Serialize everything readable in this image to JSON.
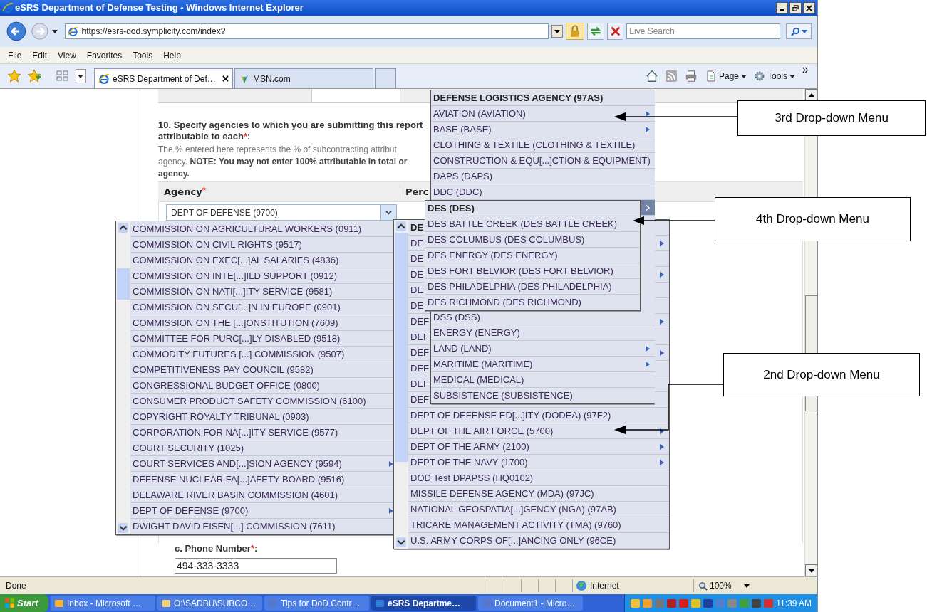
{
  "window": {
    "title": "eSRS Department of Defense Testing - Windows Internet Explorer"
  },
  "address_bar": {
    "url": "https://esrs-dod.symplicity.com/index?",
    "search_placeholder": "Live Search"
  },
  "menu_bar": [
    "File",
    "Edit",
    "View",
    "Favorites",
    "Tools",
    "Help"
  ],
  "tabs": [
    {
      "label": "eSRS Department of Def…",
      "selected": true
    },
    {
      "label": "MSN.com",
      "selected": false
    }
  ],
  "command_bar": [
    "Page",
    "Tools"
  ],
  "form": {
    "question": "10. Specify agencies to which you are submitting this report",
    "question_cont": {
      "text": "attributable to each",
      "required": "*",
      "suffix": ":"
    },
    "help_lines": [
      "The % entered here represents the % of subcontracting attribut",
      "agency. **NOTE: You may not enter 100% attributable in total or**",
      "**agency.**"
    ],
    "columns": [
      {
        "label": "Agency",
        "required": "*"
      },
      {
        "label": "Perc"
      }
    ],
    "agency_value": "DEPT OF DEFENSE (9700)",
    "phone": {
      "label": "c. Phone Number",
      "required": "*",
      "suffix": ":",
      "value": "494-333-3333"
    }
  },
  "menus": [
    {
      "items": [
        {
          "label": "COMMISSION ON AGRICULTURAL WORKERS (0911)",
          "submenu": false
        },
        {
          "label": "COMMISSION ON CIVIL RIGHTS (9517)",
          "submenu": false
        },
        {
          "label": "COMMISSION ON EXEC[...]AL SALARIES (4836)",
          "submenu": false
        },
        {
          "label": "COMMISSION ON INTE[...]ILD SUPPORT (0912)",
          "submenu": false
        },
        {
          "label": "COMMISSION ON NATI[...]ITY SERVICE (9581)",
          "submenu": false
        },
        {
          "label": "COMMISSION ON SECU[...]N IN EUROPE (0901)",
          "submenu": false
        },
        {
          "label": "COMMISSION ON THE [...]ONSTITUTION (7609)",
          "submenu": false
        },
        {
          "label": "COMMITTEE FOR PURC[...]LY DISABLED (9518)",
          "submenu": false
        },
        {
          "label": "COMMODITY FUTURES [...] COMMISSION (9507)",
          "submenu": false
        },
        {
          "label": "COMPETITIVENESS PAY COUNCIL (9582)",
          "submenu": false
        },
        {
          "label": "CONGRESSIONAL BUDGET OFFICE (0800)",
          "submenu": false
        },
        {
          "label": "CONSUMER PRODUCT SAFETY COMMISSION (6100)",
          "submenu": false
        },
        {
          "label": "COPYRIGHT ROYALTY TRIBUNAL (0903)",
          "submenu": false
        },
        {
          "label": "CORPORATION FOR NA[...]ITY SERVICE (9577)",
          "submenu": false
        },
        {
          "label": "COURT SECURITY (1025)",
          "submenu": false
        },
        {
          "label": "COURT SERVICES AND[...]SION AGENCY (9594)",
          "submenu": true
        },
        {
          "label": "DEFENSE NUCLEAR FA[...]AFETY BOARD (9516)",
          "submenu": false
        },
        {
          "label": "DELAWARE RIVER BASIN COMMISSION (4601)",
          "submenu": false
        },
        {
          "label": "DEPT OF DEFENSE (9700)",
          "submenu": true
        },
        {
          "label": "DWIGHT DAVID EISEN[...] COMMISSION (7611)",
          "submenu": false
        }
      ]
    },
    {
      "items": [
        {
          "label": "DE",
          "kind": "header",
          "submenu": false
        },
        {
          "label": "DE",
          "kind": "item",
          "submenu": true
        },
        {
          "label": "DE",
          "kind": "item",
          "submenu": false
        },
        {
          "label": "DE",
          "kind": "item",
          "submenu": true
        },
        {
          "label": "DE",
          "kind": "item",
          "submenu": false
        },
        {
          "label": "DE",
          "kind": "item",
          "submenu": false
        },
        {
          "label": "DEF",
          "kind": "item",
          "submenu": true
        },
        {
          "label": "DEF",
          "kind": "item",
          "submenu": false
        },
        {
          "label": "DEF",
          "kind": "item",
          "submenu": true
        },
        {
          "label": "DEF",
          "kind": "item",
          "submenu": false
        },
        {
          "label": "DEF",
          "kind": "item",
          "submenu": false
        },
        {
          "label": "DEF",
          "kind": "item",
          "submenu": false
        },
        {
          "label": "DEPT OF DEFENSE ED[...]ITY (DODEA) (97F2)",
          "kind": "item",
          "submenu": false
        },
        {
          "label": "DEPT OF THE AIR FORCE (5700)",
          "kind": "item",
          "submenu": true
        },
        {
          "label": "DEPT OF THE ARMY (2100)",
          "kind": "item",
          "submenu": true
        },
        {
          "label": "DEPT OF THE NAVY (1700)",
          "kind": "item",
          "submenu": true
        },
        {
          "label": "DOD Test DPAPSS (HQ0102)",
          "kind": "item",
          "submenu": false
        },
        {
          "label": "MISSILE DEFENSE AGENCY (MDA) (97JC)",
          "kind": "item",
          "submenu": false
        },
        {
          "label": "NATIONAL GEOSPATIA[...]GENCY (NGA) (97AB)",
          "kind": "item",
          "submenu": false
        },
        {
          "label": "TRICARE MANAGEMENT ACTIVITY (TMA) (9760)",
          "kind": "item",
          "submenu": false
        },
        {
          "label": "U.S. ARMY CORPS OF[...]ANCING ONLY (96CE)",
          "kind": "item",
          "submenu": false
        }
      ]
    },
    {
      "items": [
        {
          "label": "DEFENSE LOGISTICS AGENCY (97AS)",
          "kind": "header",
          "submenu": false,
          "selected": false
        },
        {
          "label": "AVIATION (AVIATION)",
          "kind": "item",
          "submenu": true,
          "selected": false
        },
        {
          "label": "BASE (BASE)",
          "kind": "item",
          "submenu": true,
          "selected": false
        },
        {
          "label": "CLOTHING & TEXTILE (CLOTHING & TEXTILE)",
          "kind": "item",
          "submenu": false,
          "selected": false
        },
        {
          "label": "CONSTRUCTION & EQU[...]CTION & EQUIPMENT)",
          "kind": "item",
          "submenu": false,
          "selected": false
        },
        {
          "label": "DAPS (DAPS)",
          "kind": "item",
          "submenu": false,
          "selected": false
        },
        {
          "label": "DDC (DDC)",
          "kind": "item",
          "submenu": false,
          "selected": false
        },
        {
          "kind": "item",
          "submenu": true,
          "selected": true
        },
        {
          "label": "DSS (DSS)",
          "kind": "item",
          "submenu": false,
          "selected": false
        },
        {
          "label": "ENERGY (ENERGY)",
          "kind": "item",
          "submenu": false,
          "selected": false
        },
        {
          "label": "LAND (LAND)",
          "kind": "item",
          "submenu": true,
          "selected": false
        },
        {
          "label": "MARITIME (MARITIME)",
          "kind": "item",
          "submenu": true,
          "selected": false
        },
        {
          "label": "MEDICAL (MEDICAL)",
          "kind": "item",
          "submenu": false,
          "selected": false
        },
        {
          "label": "SUBSISTENCE (SUBSISTENCE)",
          "kind": "item",
          "submenu": false,
          "selected": false
        }
      ]
    },
    {
      "items": [
        {
          "label": "DES (DES)",
          "kind": "header",
          "submenu": false
        },
        {
          "label": "DES BATTLE CREEK (DES BATTLE CREEK)",
          "kind": "item",
          "submenu": false
        },
        {
          "label": "DES COLUMBUS (DES COLUMBUS)",
          "kind": "item",
          "submenu": false
        },
        {
          "label": "DES ENERGY (DES ENERGY)",
          "kind": "item",
          "submenu": false
        },
        {
          "label": "DES FORT BELVIOR (DES FORT BELVIOR)",
          "kind": "item",
          "submenu": false
        },
        {
          "label": "DES PHILADELPHIA (DES PHILADELPHIA)",
          "kind": "item",
          "submenu": false
        },
        {
          "label": "DES RICHMOND (DES RICHMOND)",
          "kind": "item",
          "submenu": false
        }
      ]
    }
  ],
  "callouts": [
    "3rd Drop-down Menu",
    "4th Drop-down Menu",
    "2nd Drop-down Menu"
  ],
  "status_bar": {
    "text": "Done",
    "zone": "Internet",
    "zoom": "100%"
  },
  "taskbar": {
    "start": "Start",
    "buttons": [
      {
        "label": "Inbox - Microsoft …",
        "selected": false
      },
      {
        "label": "O:\\SADBU\\SUBCO…",
        "selected": false
      },
      {
        "label": "Tips for DoD Contr…",
        "selected": false
      },
      {
        "label": "eSRS Departme…",
        "selected": true
      },
      {
        "label": "Document1 - Micro…",
        "selected": false
      }
    ],
    "clock": "11:39 AM"
  }
}
